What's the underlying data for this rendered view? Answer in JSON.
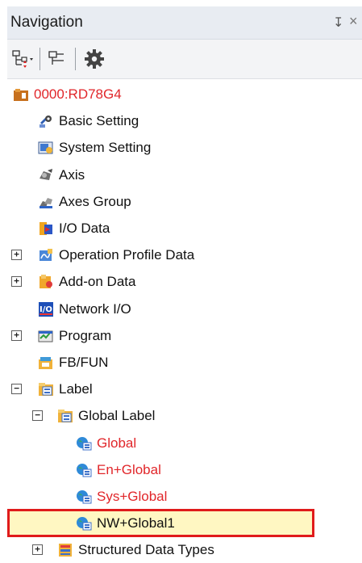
{
  "panel": {
    "title": "Navigation",
    "pin_glyph": "↧",
    "close_glyph": "×"
  },
  "toolbar": {
    "buttons": [
      {
        "name": "expand-collapse-tree-button",
        "icon": "tree-expand-icon"
      },
      {
        "name": "collapse-tree-button",
        "icon": "tree-collapse-icon"
      },
      {
        "name": "settings-button",
        "icon": "gear-icon"
      }
    ]
  },
  "tree": {
    "items": [
      {
        "label": "0000:RD78G4",
        "level": 0,
        "expander": "",
        "icon": "module-icon",
        "label_color": "#e1262a"
      },
      {
        "label": "Basic Setting",
        "level": 1,
        "expander": "",
        "icon": "basic-setting-icon"
      },
      {
        "label": "System Setting",
        "level": 1,
        "expander": "",
        "icon": "system-setting-icon"
      },
      {
        "label": "Axis",
        "level": 1,
        "expander": "",
        "icon": "axis-icon"
      },
      {
        "label": "Axes Group",
        "level": 1,
        "expander": "",
        "icon": "axes-group-icon"
      },
      {
        "label": "I/O Data",
        "level": 1,
        "expander": "",
        "icon": "io-data-icon"
      },
      {
        "label": "Operation Profile Data",
        "level": 1,
        "expander": "+",
        "icon": "operation-profile-icon"
      },
      {
        "label": "Add-on Data",
        "level": 1,
        "expander": "+",
        "icon": "addon-data-icon"
      },
      {
        "label": "Network I/O",
        "level": 1,
        "expander": "",
        "icon": "network-io-icon"
      },
      {
        "label": "Program",
        "level": 1,
        "expander": "+",
        "icon": "program-icon"
      },
      {
        "label": "FB/FUN",
        "level": 1,
        "expander": "",
        "icon": "fb-fun-icon"
      },
      {
        "label": "Label",
        "level": 1,
        "expander": "−",
        "icon": "label-folder-icon"
      },
      {
        "label": "Global Label",
        "level": 2,
        "expander": "−",
        "icon": "global-label-folder-icon"
      },
      {
        "label": "Global",
        "level": 3,
        "expander": "",
        "icon": "globe-label-icon",
        "label_color": "#e1262a"
      },
      {
        "label": "En+Global",
        "level": 3,
        "expander": "",
        "icon": "globe-label-icon",
        "label_color": "#e1262a"
      },
      {
        "label": "Sys+Global",
        "level": 3,
        "expander": "",
        "icon": "globe-label-icon",
        "label_color": "#e1262a"
      },
      {
        "label": "NW+Global1",
        "level": 3,
        "expander": "",
        "icon": "globe-label-icon",
        "selected": true
      },
      {
        "label": "Structured Data Types",
        "level": 2,
        "expander": "+",
        "icon": "structured-data-icon"
      }
    ]
  },
  "colors": {
    "selection_fill": "#fff7c2",
    "selection_border": "#e01b1b",
    "error_text": "#e1262a"
  }
}
